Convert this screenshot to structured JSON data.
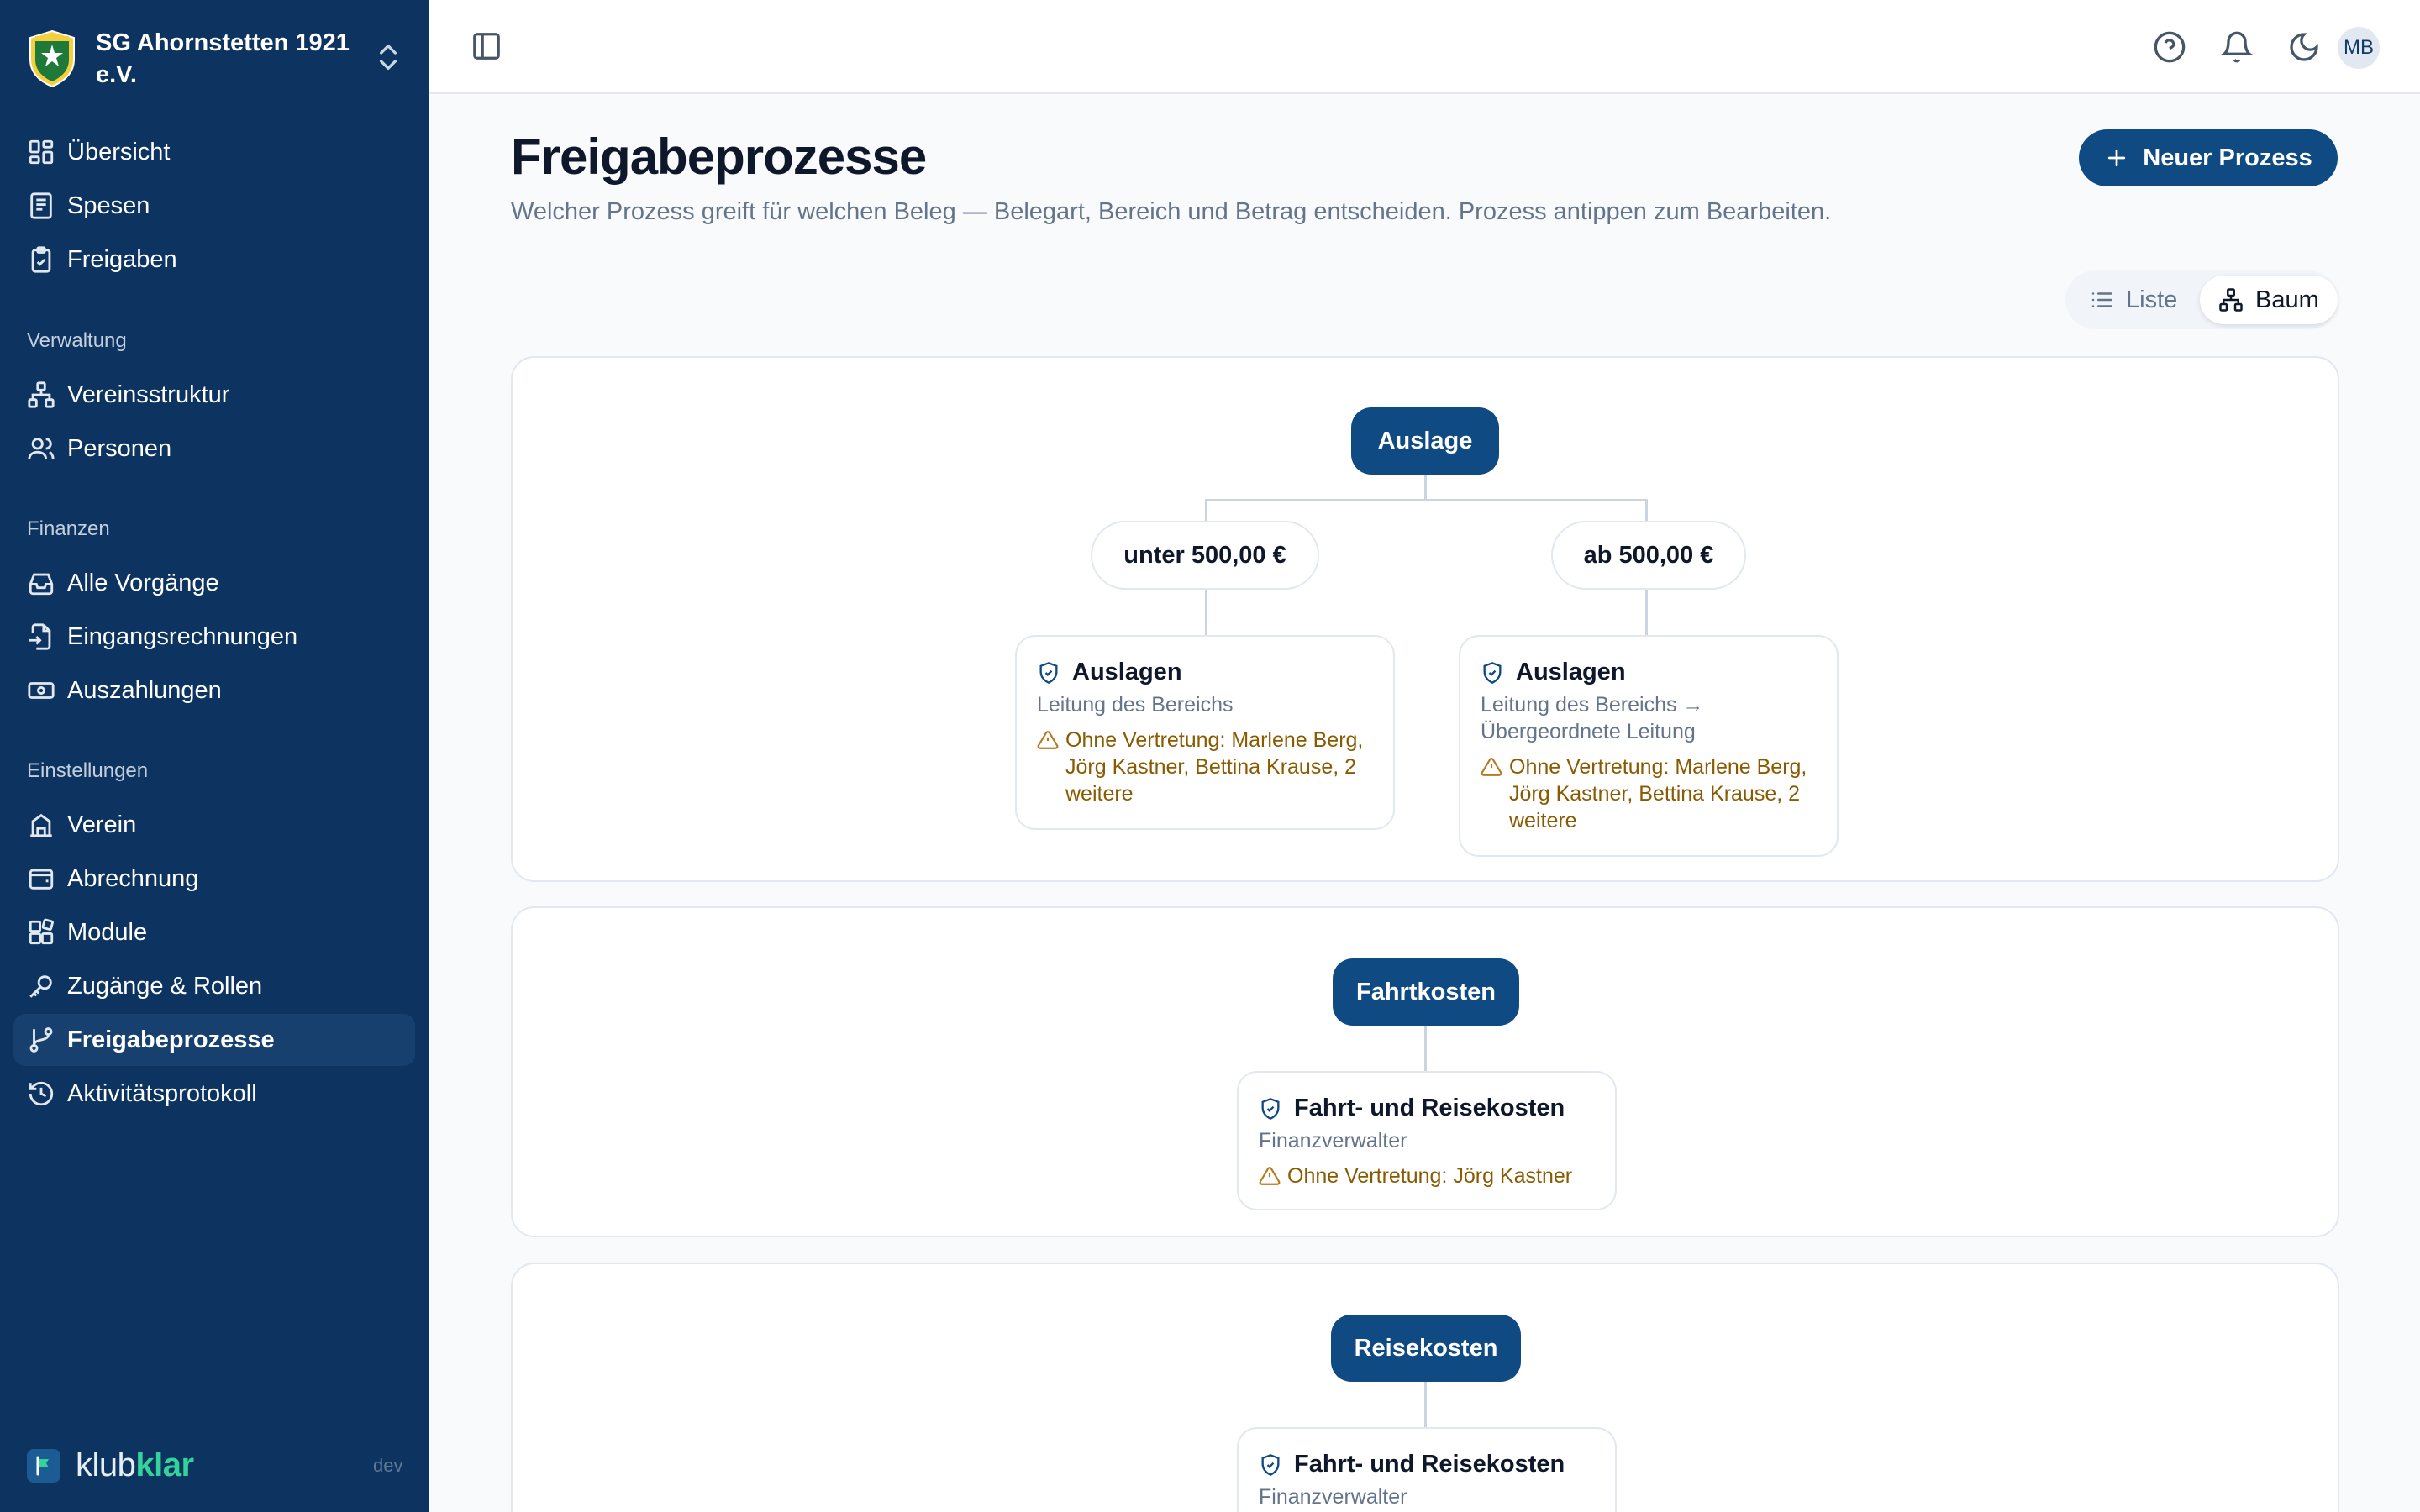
{
  "org": {
    "name": "SG Ahornstetten 1921 e.V."
  },
  "nav": {
    "main": [
      {
        "label": "Übersicht",
        "icon": "dashboard-icon"
      },
      {
        "label": "Spesen",
        "icon": "receipt-icon"
      },
      {
        "label": "Freigaben",
        "icon": "clipboard-check-icon"
      }
    ],
    "sections": {
      "verwaltung": "Verwaltung",
      "finanzen": "Finanzen",
      "einstellungen": "Einstellungen"
    },
    "verwaltung": [
      {
        "label": "Vereinsstruktur",
        "icon": "hierarchy-icon"
      },
      {
        "label": "Personen",
        "icon": "users-icon"
      }
    ],
    "finanzen": [
      {
        "label": "Alle Vorgänge",
        "icon": "inbox-icon"
      },
      {
        "label": "Eingangsrechnungen",
        "icon": "file-import-icon"
      },
      {
        "label": "Auszahlungen",
        "icon": "banknote-icon"
      }
    ],
    "einstellungen": [
      {
        "label": "Verein",
        "icon": "building-icon"
      },
      {
        "label": "Abrechnung",
        "icon": "wallet-icon"
      },
      {
        "label": "Module",
        "icon": "blocks-icon"
      },
      {
        "label": "Zugänge & Rollen",
        "icon": "key-icon"
      },
      {
        "label": "Freigabeprozesse",
        "icon": "git-branch-icon",
        "active": true
      },
      {
        "label": "Aktivitätsprotokoll",
        "icon": "history-icon"
      }
    ]
  },
  "brand": {
    "part1": "klub",
    "part2": "klar",
    "env": "dev"
  },
  "topbar": {
    "avatar_initials": "MB"
  },
  "page": {
    "title": "Freigabeprozesse",
    "subtitle": "Welcher Prozess greift für welchen Beleg — Belegart, Bereich und Betrag entscheiden. Prozess antippen zum Bearbeiten.",
    "new_button": "Neuer Prozess"
  },
  "view_toggle": {
    "list": "Liste",
    "tree": "Baum",
    "selected": "tree"
  },
  "trees": [
    {
      "root": "Auslage",
      "branches": [
        {
          "condition": "unter 500,00 €",
          "process": {
            "title": "Auslagen",
            "role": "Leitung des Bereichs",
            "warning": "Ohne Vertretung: Marlene Berg, Jörg Kastner, Bettina Krause, 2 weitere"
          }
        },
        {
          "condition": "ab 500,00 €",
          "process": {
            "title": "Auslagen",
            "role": "Leitung des Bereichs → Übergeordnete Leitung",
            "warning": "Ohne Vertretung: Marlene Berg, Jörg Kastner, Bettina Krause, 2 weitere"
          }
        }
      ]
    },
    {
      "root": "Fahrtkosten",
      "process": {
        "title": "Fahrt- und Reisekosten",
        "role": "Finanzverwalter",
        "warning": "Ohne Vertretung: Jörg Kastner"
      }
    },
    {
      "root": "Reisekosten",
      "process": {
        "title": "Fahrt- und Reisekosten",
        "role": "Finanzverwalter"
      }
    }
  ],
  "colors": {
    "sidebar": "#0d3461",
    "primary": "#0f4a83",
    "accent": "#34d399",
    "warning": "#8a5a00"
  }
}
